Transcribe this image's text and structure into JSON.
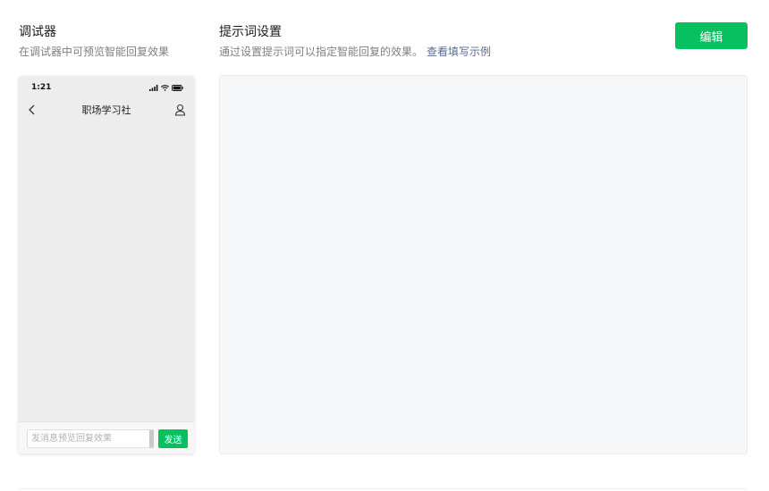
{
  "colors": {
    "accent": "#07c160",
    "link": "#576b95",
    "phone_bg": "#ededed",
    "prompt_bg": "#f6f7f9"
  },
  "debugger": {
    "title": "调试器",
    "description": "在调试器中可预览智能回复效果"
  },
  "prompt_settings": {
    "title": "提示词设置",
    "description": "通过设置提示词可以指定智能回复的效果。",
    "example_link": "查看填写示例",
    "edit_label": "编辑",
    "content": ""
  },
  "phone": {
    "status_time": "1:21",
    "status_icons": [
      "signal-icon",
      "wifi-icon",
      "battery-icon"
    ],
    "chat_title": "职场学习社",
    "back_icon": "chevron-left-icon",
    "profile_icon": "user-icon",
    "input_placeholder": "发消息预览回复效果",
    "send_label": "发送"
  }
}
